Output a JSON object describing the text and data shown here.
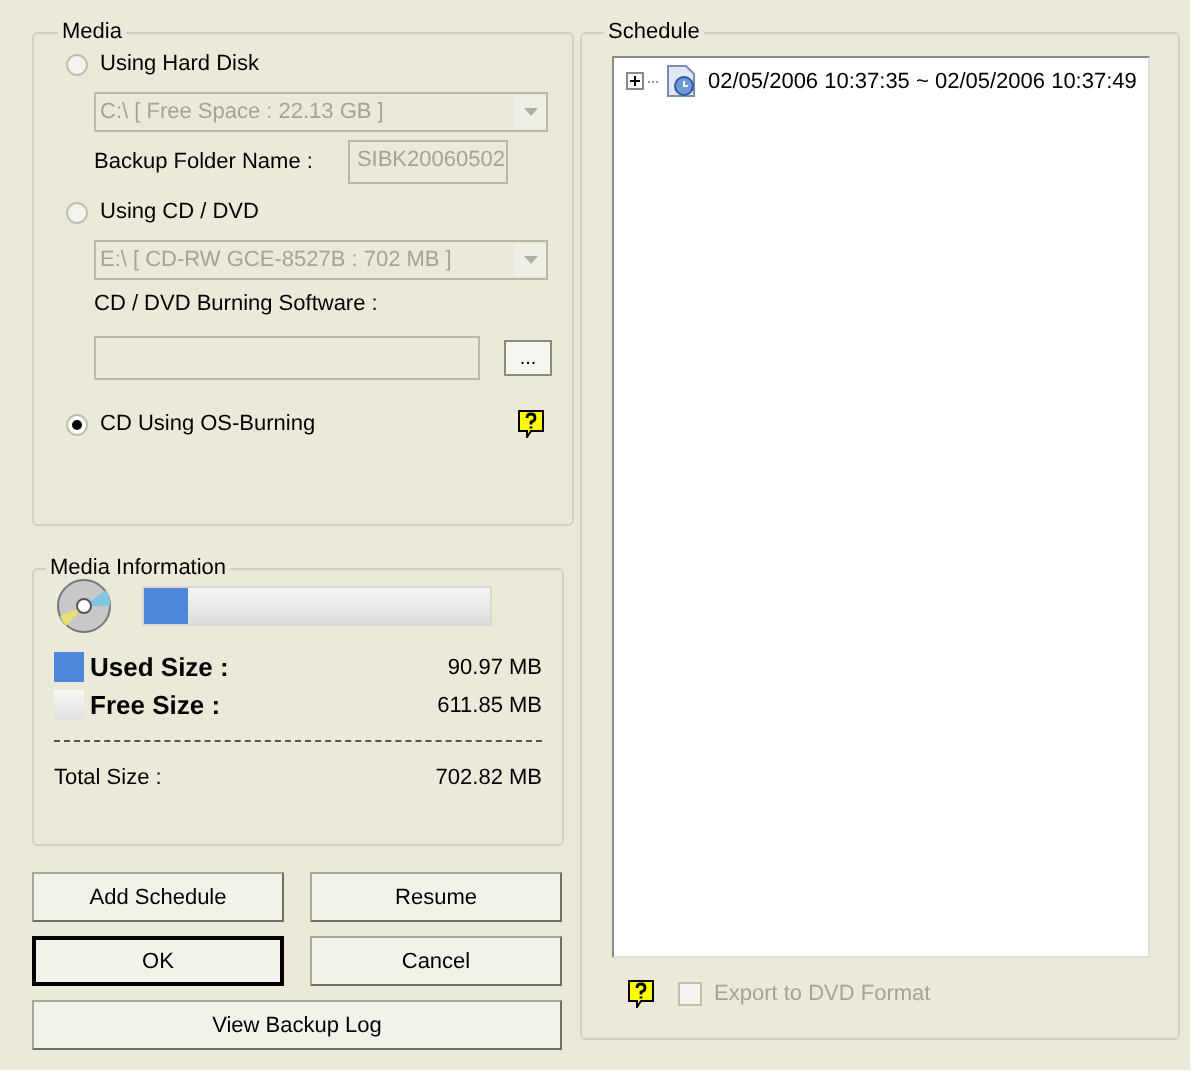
{
  "media": {
    "title": "Media",
    "options": [
      {
        "label": "Using Hard Disk",
        "selected": false
      },
      {
        "label": "Using CD / DVD",
        "selected": false
      },
      {
        "label": "CD Using OS-Burning",
        "selected": true
      }
    ],
    "hard_disk": {
      "drive": "C:\\ [ Free Space : 22.13 GB ]",
      "disabled": true,
      "folder_label": "Backup Folder Name :",
      "folder_value": "SIBK20060502"
    },
    "cd_dvd": {
      "drive": "E:\\ [ CD-RW GCE-8527B : 702 MB ]",
      "disabled": true,
      "software_label": "CD / DVD Burning Software :",
      "browse": "..."
    }
  },
  "media_information": {
    "title": "Media Information",
    "level": 0.129,
    "used_label": "Used Size :",
    "used_value": "90.97 MB",
    "free_label": "Free Size :",
    "free_value": "611.85 MB",
    "total_label": "Total Size :",
    "total_value": "702.82 MB"
  },
  "buttons": [
    {
      "label": "Add Schedule",
      "default": false
    },
    {
      "label": "Resume",
      "default": false
    },
    {
      "label": "OK",
      "default": true
    },
    {
      "label": "Cancel",
      "default": false
    },
    {
      "label": "View Backup Log",
      "default": false
    }
  ],
  "schedule": {
    "title": "Schedule",
    "items": [
      {
        "label": "02/05/2006 10:37:35 ~ 02/05/2006 10:37:49",
        "expanded": false
      }
    ],
    "export": {
      "label": "Export to DVD Format",
      "checked": false,
      "disabled": true
    }
  }
}
